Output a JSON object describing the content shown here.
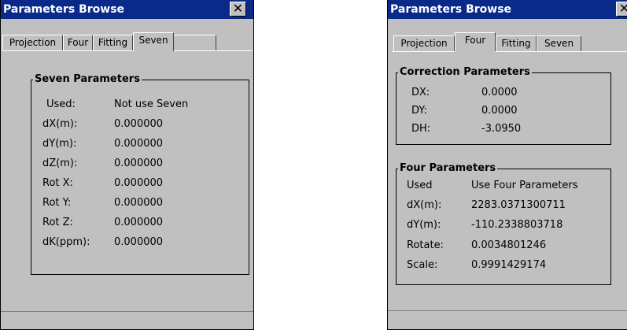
{
  "left_window": {
    "title": "Parameters Browse",
    "close_glyph": "✕",
    "tabs": [
      "Projection",
      "Four",
      "Fitting",
      "Seven"
    ],
    "active_tab": "Seven",
    "group_title": "Seven Parameters",
    "rows": [
      {
        "label": "Used:",
        "value": "Not use Seven"
      },
      {
        "label": "dX(m):",
        "value": "0.000000"
      },
      {
        "label": "dY(m):",
        "value": "0.000000"
      },
      {
        "label": "dZ(m):",
        "value": "0.000000"
      },
      {
        "label": "Rot X:",
        "value": "0.000000"
      },
      {
        "label": "Rot Y:",
        "value": "0.000000"
      },
      {
        "label": "Rot Z:",
        "value": "0.000000"
      },
      {
        "label": "dK(ppm):",
        "value": "0.000000"
      }
    ]
  },
  "right_window": {
    "title": "Parameters Browse",
    "close_glyph": "✕",
    "tabs": [
      "Projection",
      "Four",
      "Fitting",
      "Seven"
    ],
    "active_tab": "Four",
    "correction_title": "Correction Parameters",
    "correction_rows": [
      {
        "label": "DX:",
        "value": "0.0000"
      },
      {
        "label": "DY:",
        "value": "0.0000"
      },
      {
        "label": "DH:",
        "value": "-3.0950"
      }
    ],
    "four_title": "Four Parameters",
    "four_rows": [
      {
        "label": "Used",
        "value": "Use Four Parameters"
      },
      {
        "label": "dX(m):",
        "value": "2283.0371300711"
      },
      {
        "label": "dY(m):",
        "value": "-110.2338803718"
      },
      {
        "label": "Rotate:",
        "value": "0.0034801246"
      },
      {
        "label": "Scale:",
        "value": "0.9991429174"
      }
    ]
  }
}
